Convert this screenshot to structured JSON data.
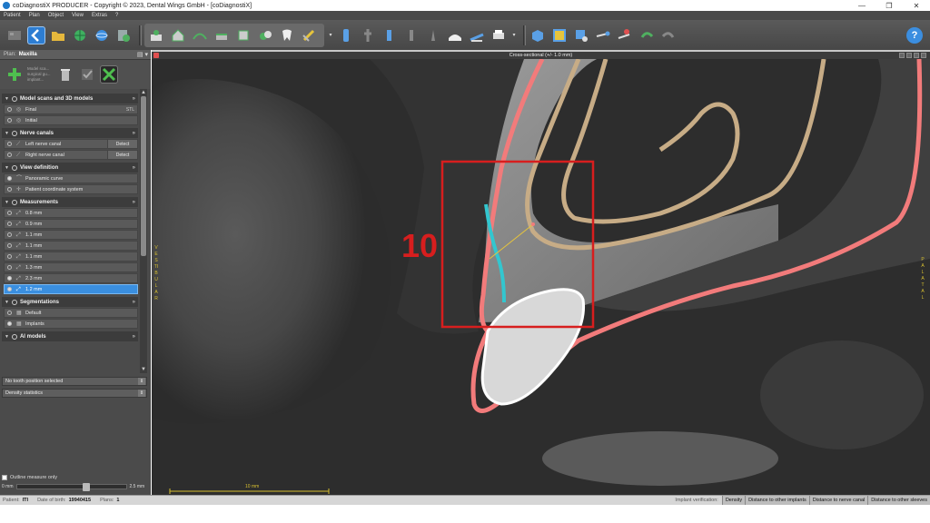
{
  "window": {
    "title": "coDiagnostiX PRODUCER - Copyright © 2023, Dental Wings GmbH - [coDiagnostiX]",
    "minimize": "—",
    "maximize": "❐",
    "close": "✕"
  },
  "menu": [
    "Patient",
    "Plan",
    "Object",
    "View",
    "Extras",
    "?"
  ],
  "plan": {
    "label": "Plan:",
    "value": "Maxilla",
    "tools_text": "Model sca... surgical gu... implant..."
  },
  "sections": {
    "model_scans": {
      "title": "Model scans and 3D models",
      "items": [
        {
          "label": "Final",
          "right": "STL"
        },
        {
          "label": "Initial"
        }
      ]
    },
    "nerve_canals": {
      "title": "Nerve canals",
      "detect_label": "Detect",
      "items": [
        {
          "label": "Left nerve canal"
        },
        {
          "label": "Right nerve canal"
        }
      ]
    },
    "view_definition": {
      "title": "View definition",
      "items": [
        {
          "label": "Panoramic curve"
        },
        {
          "label": "Patient coordinate system"
        }
      ]
    },
    "measurements": {
      "title": "Measurements",
      "items": [
        {
          "label": "0.8 mm"
        },
        {
          "label": "0.9 mm"
        },
        {
          "label": "1.1 mm"
        },
        {
          "label": "1.1 mm"
        },
        {
          "label": "1.1 mm"
        },
        {
          "label": "1.3 mm"
        },
        {
          "label": "2.3 mm"
        },
        {
          "label": "1.2 mm"
        }
      ]
    },
    "segmentations": {
      "title": "Segmentations",
      "items": [
        {
          "label": "Default"
        },
        {
          "label": "Implants"
        }
      ]
    },
    "ai_models": {
      "title": "AI models"
    }
  },
  "dropdowns": {
    "tooth_position": "No tooth position selected",
    "density": "Density statistics"
  },
  "outline": {
    "label": "Outline measure only",
    "min": "0 mm",
    "max": "2.5 mm"
  },
  "viewport": {
    "title": "Cross-sectional (+/- 1.0 mm)",
    "left_label": "VESTIBULAR",
    "right_label": "PALATAL",
    "scale": "10 mm",
    "overlay_number": "10"
  },
  "status": {
    "patient_label": "Patient:",
    "patient_value": "ITI",
    "dob_label": "Date of birth:",
    "dob_value": "19940415",
    "plans_label": "Plans:",
    "plans_value": "1",
    "implant_verification": "Implant verification:",
    "buttons": [
      "Density",
      "Distance to other implants",
      "Distance to nerve canal",
      "Distance to other sleeves"
    ]
  },
  "colors": {
    "accent": "#3a8fe0",
    "outline_red": "#f27b7b",
    "tan": "#c7ac86",
    "cyan": "#33c6cf",
    "highlight_red": "#d71e1e"
  }
}
